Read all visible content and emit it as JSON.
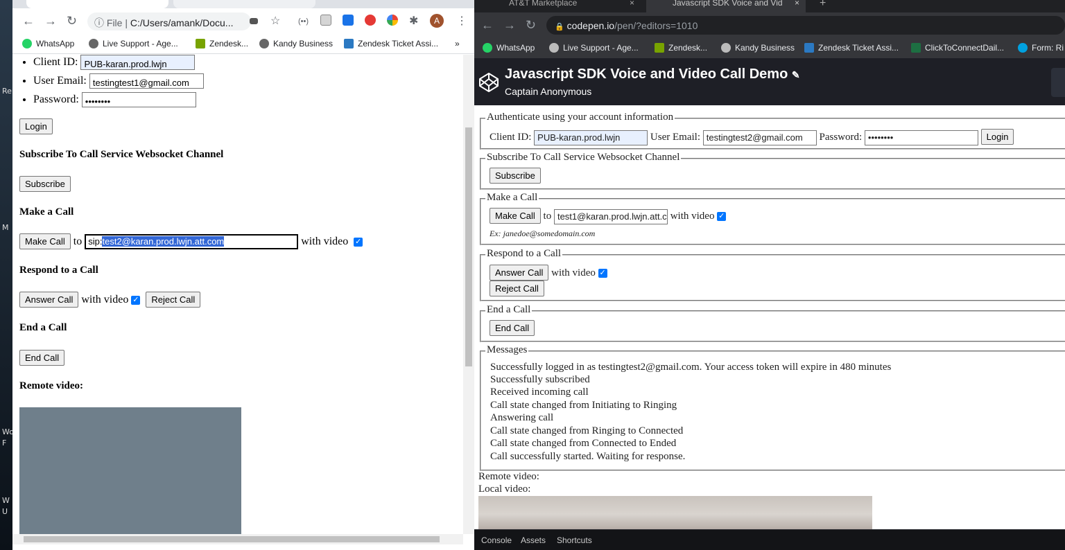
{
  "desktop": {
    "labels": [
      "Re",
      "M",
      "Wo",
      "F",
      "W",
      "U"
    ]
  },
  "left": {
    "address": {
      "file_label": "File",
      "path": "C:/Users/amank/Docu..."
    },
    "profile_letter": "A",
    "bookmarks": [
      "WhatsApp",
      "Live Support - Age...",
      "Zendesk...",
      "Kandy Business",
      "Zendesk Ticket Assi...",
      "»"
    ],
    "form": {
      "client_id_label": "Client ID:",
      "client_id_value": "PUB-karan.prod.lwjn",
      "email_label": "User Email:",
      "email_value": "testingtest1@gmail.com",
      "password_label": "Password:",
      "password_value": "••••••••",
      "login": "Login"
    },
    "subscribe_heading": "Subscribe To Call Service Websocket Channel",
    "subscribe_button": "Subscribe",
    "call_heading": "Make a Call",
    "make_call_button": "Make Call",
    "to_label": "to",
    "callee_prefix": "sip:",
    "callee_selected": "test2@karan.prod.lwjn.att.com",
    "with_video": "with video",
    "respond_heading": "Respond to a Call",
    "answer_button": "Answer Call",
    "reject_button": "Reject Call",
    "end_heading": "End a Call",
    "end_button": "End Call",
    "remote_heading": "Remote video:"
  },
  "right": {
    "tabs": [
      "AT&T Marketplace",
      "Javascript SDK Voice and Vid"
    ],
    "address": {
      "host": "codepen.io",
      "path": "/pen/?editors=1010"
    },
    "bookmarks": [
      "WhatsApp",
      "Live Support - Age...",
      "Zendesk...",
      "Kandy Business",
      "Zendesk Ticket Assi...",
      "ClickToConnectDail...",
      "Form: Ri"
    ],
    "pen_title": "Javascript SDK Voice and Video Call Demo",
    "pen_author": "Captain Anonymous",
    "auth": {
      "legend": "Authenticate using your account information",
      "client_id_label": "Client ID:",
      "client_id_value": "PUB-karan.prod.lwjn",
      "email_label": "User Email:",
      "email_value": "testingtest2@gmail.com",
      "password_label": "Password:",
      "password_value": "••••••••",
      "login": "Login"
    },
    "subscribe": {
      "legend": "Subscribe To Call Service Websocket Channel",
      "button": "Subscribe"
    },
    "make_call": {
      "legend": "Make a Call",
      "button": "Make Call",
      "to": "to",
      "callee": "test1@karan.prod.lwjn.att.c",
      "with_video": "with video",
      "hint": "Ex: janedoe@somedomain.com"
    },
    "respond": {
      "legend": "Respond to a Call",
      "answer": "Answer Call",
      "with_video": "with video",
      "reject": "Reject Call"
    },
    "end": {
      "legend": "End a Call",
      "button": "End Call"
    },
    "messages": {
      "legend": "Messages",
      "lines": [
        "Successfully logged in as testingtest2@gmail.com. Your access token will expire in 480 minutes",
        "Successfully subscribed",
        "Received incoming call",
        "Call state changed from Initiating to Ringing",
        "Answering call",
        "Call state changed from Ringing to Connected",
        "Call state changed from Connected to Ended",
        "Call successfully started. Waiting for response."
      ]
    },
    "remote_video": "Remote video:",
    "local_video": "Local video:",
    "footer": [
      "Console",
      "Assets",
      "Shortcuts"
    ]
  },
  "colors": {
    "checkbox": "#0075ff",
    "codepen_header": "#1e1f26",
    "dark_chrome": "#35363a",
    "remote_video_bg": "#6f7f8b"
  }
}
